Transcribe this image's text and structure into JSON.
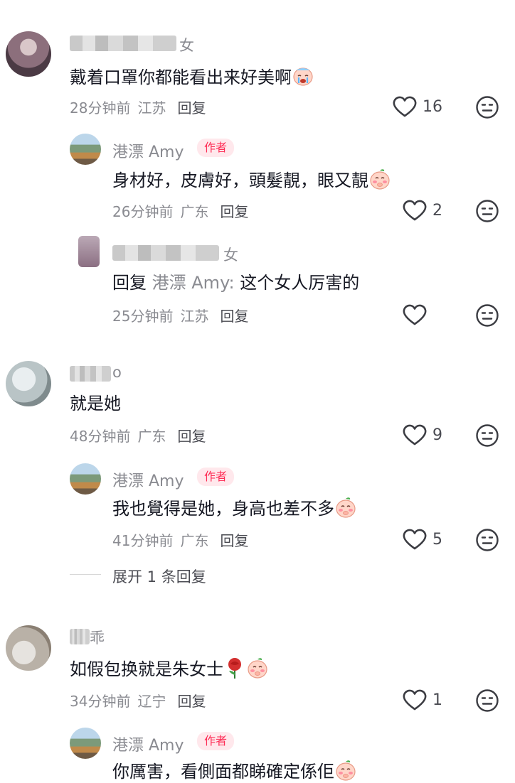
{
  "comments": [
    {
      "name_suffix": "女",
      "text": "戴着口罩你都能看出来好美啊",
      "emoji": "crying-face",
      "time": "28分钟前",
      "location": "江苏",
      "reply_label": "回复",
      "likes": "16"
    },
    {
      "name_suffix": "o",
      "text": "就是她",
      "time": "48分钟前",
      "location": "广东",
      "reply_label": "回复",
      "likes": "9"
    },
    {
      "name_suffix": "乖",
      "text": "如假包换就是朱女士",
      "emoji": [
        "rose",
        "shy-face"
      ],
      "time": "34分钟前",
      "location": "辽宁",
      "reply_label": "回复",
      "likes": "1"
    }
  ],
  "replies": [
    {
      "username": "港漂 Amy",
      "badge": "作者",
      "text": "身材好，皮膚好，頭髮靚，眼又靚",
      "emoji": "shy-face",
      "time": "26分钟前",
      "location": "广东",
      "reply_label": "回复",
      "likes": "2"
    },
    {
      "name_suffix": "女",
      "reply_prefix": "回复",
      "reply_target": "港漂 Amy:",
      "text": "这个女人厉害的",
      "time": "25分钟前",
      "location": "江苏",
      "reply_label": "回复",
      "likes": ""
    },
    {
      "username": "港漂 Amy",
      "badge": "作者",
      "text": "我也覺得是她，身高也差不多",
      "emoji": "shy-face",
      "time": "41分钟前",
      "location": "广东",
      "reply_label": "回复",
      "likes": "5"
    },
    {
      "username": "港漂 Amy",
      "badge": "作者",
      "text": "你厲害，看側面都睇確定係佢",
      "emoji": "shy-face"
    }
  ],
  "expand_replies": "展开 1 条回复",
  "icons": {
    "like": "heart-outline-icon",
    "dislike": "neutral-face-icon"
  },
  "colors": {
    "accent": "#fe2c55",
    "muted": "#8a8b91",
    "text": "#161823"
  }
}
